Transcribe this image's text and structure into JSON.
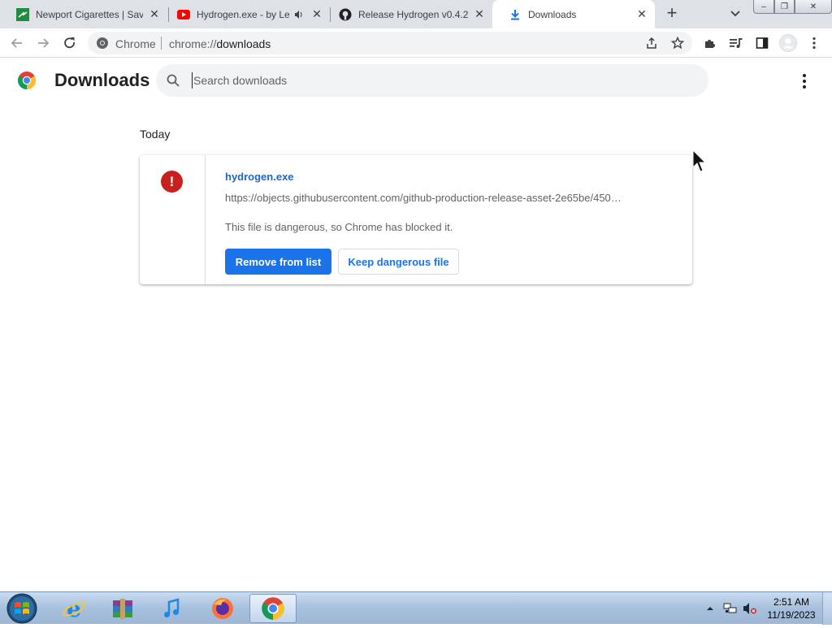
{
  "tabs": [
    {
      "title": "Newport Cigarettes | Save",
      "favicon": "newport-icon",
      "close_label": "✕"
    },
    {
      "title": "Hydrogen.exe - by Le",
      "favicon": "youtube-icon",
      "audio": "speaker-icon",
      "close_label": "✕"
    },
    {
      "title": "Release Hydrogen v0.4.2",
      "favicon": "github-icon",
      "close_label": "✕"
    },
    {
      "title": "Downloads",
      "favicon": "download-icon",
      "close_label": "✕",
      "active": true
    }
  ],
  "new_tab_label": "+",
  "window_controls": {
    "minimize": "‒",
    "restore": "❐",
    "close": "✕"
  },
  "omnibox": {
    "chip": "Chrome",
    "url_scheme": "chrome://",
    "url_host": "downloads"
  },
  "downloads_page": {
    "title": "Downloads",
    "search_placeholder": "Search downloads",
    "date_heading": "Today",
    "items": [
      {
        "file_name": "hydrogen.exe",
        "url": "https://objects.githubusercontent.com/github-production-release-asset-2e65be/450…",
        "status": "This file is dangerous, so Chrome has blocked it.",
        "primary_action": "Remove from list",
        "secondary_action": "Keep dangerous file",
        "status_icon": "!"
      }
    ]
  },
  "taskbar": {
    "apps": [
      "internet-explorer-icon",
      "winrar-icon",
      "itunes-icon",
      "firefox-icon",
      "chrome-icon"
    ],
    "active_app": "chrome-icon",
    "clock_time": "2:51 AM",
    "clock_date": "11/19/2023"
  },
  "colors": {
    "accent": "#1a73e8",
    "link": "#1967d2",
    "danger": "#c5221f",
    "tabstrip": "#dee1e6"
  }
}
